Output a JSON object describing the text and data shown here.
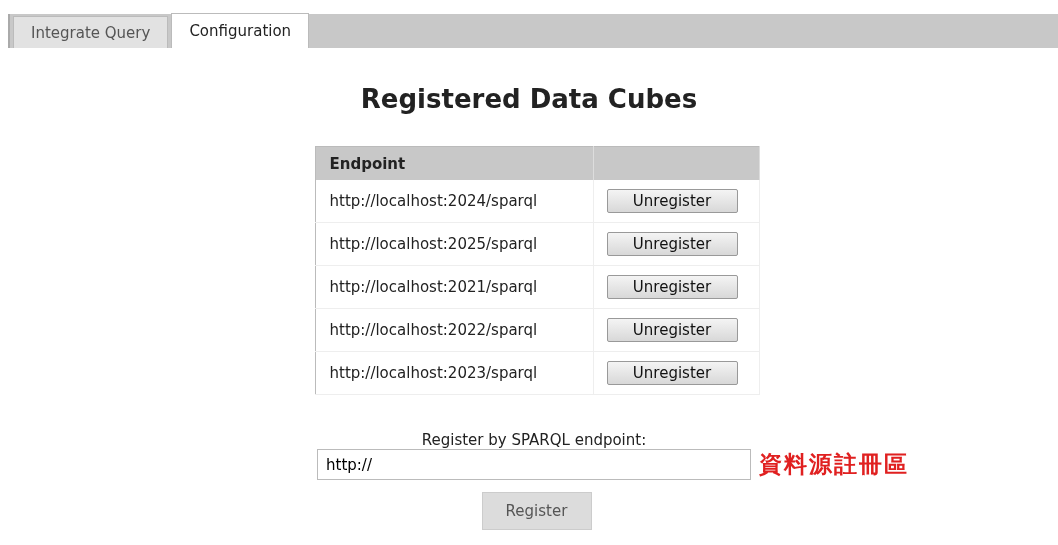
{
  "tabs": [
    {
      "label": "Integrate Query",
      "selected": false
    },
    {
      "label": "Configuration",
      "selected": true
    }
  ],
  "title": "Registered Data Cubes",
  "table": {
    "columns": [
      "Endpoint"
    ],
    "rows": [
      {
        "endpoint": "http://localhost:2024/sparql",
        "action": "Unregister"
      },
      {
        "endpoint": "http://localhost:2025/sparql",
        "action": "Unregister"
      },
      {
        "endpoint": "http://localhost:2021/sparql",
        "action": "Unregister"
      },
      {
        "endpoint": "http://localhost:2022/sparql",
        "action": "Unregister"
      },
      {
        "endpoint": "http://localhost:2023/sparql",
        "action": "Unregister"
      }
    ]
  },
  "register": {
    "label": "Register by SPARQL endpoint:",
    "value": "http://",
    "annotation": "資料源註冊區",
    "button": "Register"
  }
}
